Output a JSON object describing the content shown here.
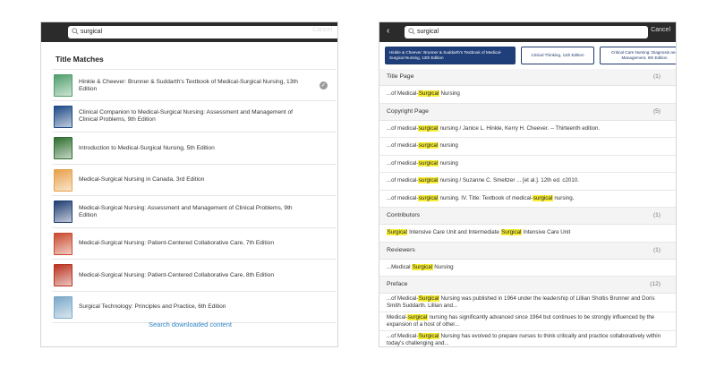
{
  "left": {
    "search": {
      "query": "surgical",
      "cancel_label": "Cancel"
    },
    "section_title": "Title Matches",
    "results": [
      {
        "title": "Hinkle & Cheever: Brunner & Suddarth's Textbook of Medical-Surgical Nursing, 13th Edition",
        "downloaded": true,
        "cover_color": "#4f9e6a"
      },
      {
        "title": "Clinical Companion to Medical-Surgical Nursing: Assessment and Management of Clinical Problems,  9th Edition",
        "cover_color": "#1f4a86"
      },
      {
        "title": "Introduction to Medical-Surgical Nursing,  5th Edition",
        "cover_color": "#2f6e2f"
      },
      {
        "title": "Medical-Surgical Nursing in Canada,  3rd Edition",
        "cover_color": "#e7a14a"
      },
      {
        "title": "Medical-Surgical Nursing: Assessment and Management of Clinical Problems,  9th Edition",
        "cover_color": "#203e72"
      },
      {
        "title": "Medical-Surgical Nursing: Patient-Centered Collaborative Care,  7th Edition",
        "cover_color": "#c94a2e"
      },
      {
        "title": "Medical-Surgical Nursing: Patient-Centered Collaborative Care,  8th Edition",
        "cover_color": "#b8321e"
      },
      {
        "title": "Surgical Technology: Principles and Practice,  6th Edition",
        "cover_color": "#7aa8c8"
      }
    ],
    "footer_link": "Search downloaded content"
  },
  "right": {
    "search": {
      "query": "surgical",
      "cancel_label": "Cancel"
    },
    "books": [
      {
        "label": "Hinkle & Cheever: Brunner & Suddarth's Textbook of Medical-Surgical Nursing, 13th Edition",
        "selected": true
      },
      {
        "label": "Critical Thinking, 11th Edition"
      },
      {
        "label": "Critical Care Nursing: Diagnosis and Management,  6th Edition"
      }
    ],
    "sections": [
      {
        "name": "Title Page",
        "count": "(1)",
        "items": [
          {
            "pre": "...of Medical-",
            "hit": "Surgical",
            "post": " Nursing"
          }
        ]
      },
      {
        "name": "Copyright Page",
        "count": "(5)",
        "items": [
          {
            "pre": "...of medical-",
            "hit": "surgical",
            "post": " nursing / Janice L. Hinkle, Kerry H. Cheever. -- Thirteenth edition."
          },
          {
            "pre": "...of medical-",
            "hit": "surgical",
            "post": " nursing"
          },
          {
            "pre": "...of medical-",
            "hit": "surgical",
            "post": " nursing"
          },
          {
            "pre": "...of medical-",
            "hit": "surgical",
            "post": " nursing / Suzanne C. Smeltzer ... [et al.]. 12th ed. c2010."
          },
          {
            "pre": "...of medical-",
            "hit": "surgical",
            "post": " nursing. IV. Title: Textbook of medical-",
            "hit2": "surgical",
            "post2": " nursing."
          }
        ]
      },
      {
        "name": "Contributors",
        "count": "(1)",
        "items": [
          {
            "pre": "",
            "hit": "Surgical",
            "post": " Intensive Care Unit and Intermediate ",
            "hit2": "Surgical",
            "post2": " Intensive Care Unit"
          }
        ]
      },
      {
        "name": "Reviewers",
        "count": "(1)",
        "items": [
          {
            "pre": "...Medical ",
            "hit": "Surgical",
            "post": " Nursing"
          }
        ]
      },
      {
        "name": "Preface",
        "count": "(12)",
        "items": [
          {
            "pre": "...of Medical-",
            "hit": "Surgical",
            "post": " Nursing was published in 1964 under the leadership of Lillian Sholtis Brunner and Doris Smith Suddarth. Lillian and...",
            "two": true
          },
          {
            "pre": "Medical-",
            "hit": "surgical",
            "post": " nursing has significantly advanced since 1964 but continues to be strongly influenced by the expansion of a host of other...",
            "two": true
          },
          {
            "pre": "...of Medical-",
            "hit": "Surgical",
            "post": " Nursing has evolved to prepare nurses to think critically and practice collaboratively within today's challenging and...",
            "two": true
          }
        ]
      }
    ]
  }
}
